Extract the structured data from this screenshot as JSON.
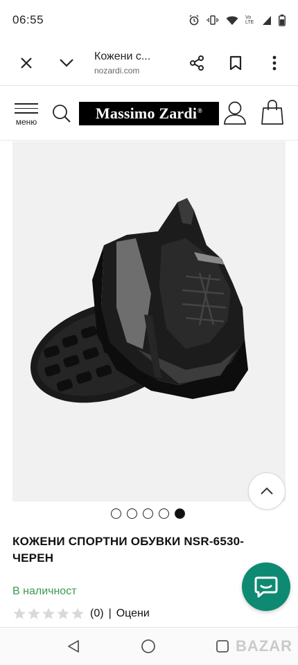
{
  "status_bar": {
    "time": "06:55",
    "icons": [
      "alarm-icon",
      "vibrate-icon",
      "wifi-icon",
      "signal-icon",
      "battery-icon"
    ],
    "network_label": "Vo LTE"
  },
  "browser": {
    "tab_title": "Кожени с...",
    "url": "nozardi.com"
  },
  "site": {
    "menu_label": "меню",
    "logo_text": "Massimo Zardi",
    "logo_mark": "®"
  },
  "product": {
    "image_alt": "black leather sneaker",
    "carousel": {
      "total": 5,
      "active_index": 5
    },
    "title": "КОЖЕНИ СПОРТНИ ОБУВКИ NSR-6530-ЧЕРЕН",
    "stock": "В наличност",
    "rating": {
      "value": 0,
      "max": 5,
      "count_text": "(0)",
      "separator": "|",
      "review_link": "Оцени"
    }
  },
  "watermark": "BAZAR",
  "colors": {
    "brand": "#000000",
    "stock": "#3a9a4c",
    "chat": "#0f8a72",
    "background": "#ffffff"
  }
}
